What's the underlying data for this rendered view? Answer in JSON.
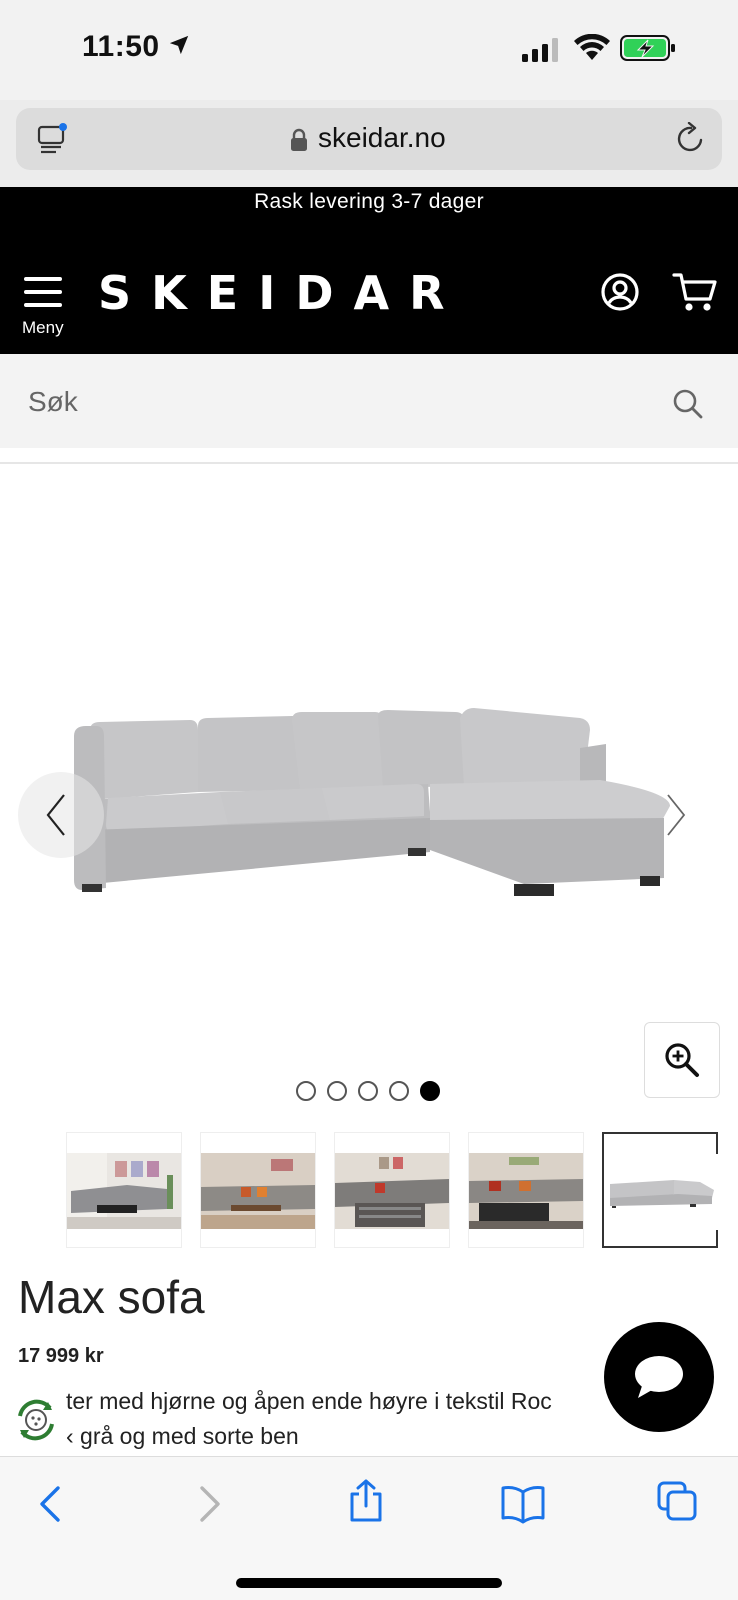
{
  "status_bar": {
    "time": "11:50",
    "battery_color": "#30d158"
  },
  "browser": {
    "url": "skeidar.no"
  },
  "promo": {
    "text": "Rask levering 3-7 dager"
  },
  "header": {
    "logo": "SKEIDAR",
    "menu_label": "Meny"
  },
  "search": {
    "placeholder": "Søk"
  },
  "gallery": {
    "dot_count": 5,
    "active_index": 4,
    "thumbnail_count": 5
  },
  "product": {
    "title": "Max sofa",
    "price": "17 999 kr",
    "description_line1": "ter med hjørne og åpen ende høyre i tekstil Roc",
    "description_line2": "‹ grå og med sorte ben"
  },
  "colors": {
    "header_bg": "#000000",
    "ios_blue": "#1a73e8",
    "eco_green": "#2e7d32"
  }
}
